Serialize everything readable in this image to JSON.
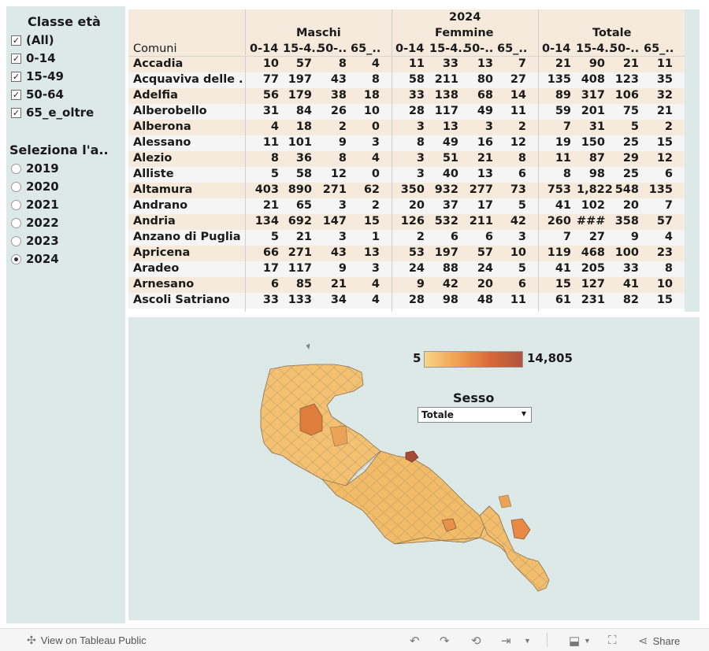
{
  "filters": {
    "age_class": {
      "title": "Classe età",
      "options": [
        {
          "label": "(All)",
          "checked": true
        },
        {
          "label": "0-14",
          "checked": true
        },
        {
          "label": "15-49",
          "checked": true
        },
        {
          "label": "50-64",
          "checked": true
        },
        {
          "label": "65_e_oltre",
          "checked": true
        }
      ]
    },
    "year": {
      "title": "Seleziona l'a..",
      "options": [
        {
          "label": "2019",
          "selected": false
        },
        {
          "label": "2020",
          "selected": false
        },
        {
          "label": "2021",
          "selected": false
        },
        {
          "label": "2022",
          "selected": false
        },
        {
          "label": "2023",
          "selected": false
        },
        {
          "label": "2024",
          "selected": true
        }
      ]
    }
  },
  "table": {
    "year_header": "2024",
    "row_header": "Comuni",
    "groups": [
      "Maschi",
      "Femmine",
      "Totale"
    ],
    "subcolumns": [
      "0-14",
      "15-4..",
      "50-..",
      "65_.."
    ],
    "rows": [
      {
        "name": "Accadia",
        "values": [
          "10",
          "57",
          "8",
          "4",
          "11",
          "33",
          "13",
          "7",
          "21",
          "90",
          "21",
          "11"
        ]
      },
      {
        "name": "Acquaviva delle ..",
        "values": [
          "77",
          "197",
          "43",
          "8",
          "58",
          "211",
          "80",
          "27",
          "135",
          "408",
          "123",
          "35"
        ]
      },
      {
        "name": "Adelfia",
        "values": [
          "56",
          "179",
          "38",
          "18",
          "33",
          "138",
          "68",
          "14",
          "89",
          "317",
          "106",
          "32"
        ]
      },
      {
        "name": "Alberobello",
        "values": [
          "31",
          "84",
          "26",
          "10",
          "28",
          "117",
          "49",
          "11",
          "59",
          "201",
          "75",
          "21"
        ]
      },
      {
        "name": "Alberona",
        "values": [
          "4",
          "18",
          "2",
          "0",
          "3",
          "13",
          "3",
          "2",
          "7",
          "31",
          "5",
          "2"
        ]
      },
      {
        "name": "Alessano",
        "values": [
          "11",
          "101",
          "9",
          "3",
          "8",
          "49",
          "16",
          "12",
          "19",
          "150",
          "25",
          "15"
        ]
      },
      {
        "name": "Alezio",
        "values": [
          "8",
          "36",
          "8",
          "4",
          "3",
          "51",
          "21",
          "8",
          "11",
          "87",
          "29",
          "12"
        ]
      },
      {
        "name": "Alliste",
        "values": [
          "5",
          "58",
          "12",
          "0",
          "3",
          "40",
          "13",
          "6",
          "8",
          "98",
          "25",
          "6"
        ]
      },
      {
        "name": "Altamura",
        "values": [
          "403",
          "890",
          "271",
          "62",
          "350",
          "932",
          "277",
          "73",
          "753",
          "1,822",
          "548",
          "135"
        ]
      },
      {
        "name": "Andrano",
        "values": [
          "21",
          "65",
          "3",
          "2",
          "20",
          "37",
          "17",
          "5",
          "41",
          "102",
          "20",
          "7"
        ]
      },
      {
        "name": "Andria",
        "values": [
          "134",
          "692",
          "147",
          "15",
          "126",
          "532",
          "211",
          "42",
          "260",
          "###",
          "358",
          "57"
        ]
      },
      {
        "name": "Anzano di Puglia",
        "values": [
          "5",
          "21",
          "3",
          "1",
          "2",
          "6",
          "6",
          "3",
          "7",
          "27",
          "9",
          "4"
        ]
      },
      {
        "name": "Apricena",
        "values": [
          "66",
          "271",
          "43",
          "13",
          "53",
          "197",
          "57",
          "10",
          "119",
          "468",
          "100",
          "23"
        ]
      },
      {
        "name": "Aradeo",
        "values": [
          "17",
          "117",
          "9",
          "3",
          "24",
          "88",
          "24",
          "5",
          "41",
          "205",
          "33",
          "8"
        ]
      },
      {
        "name": "Arnesano",
        "values": [
          "6",
          "85",
          "21",
          "4",
          "9",
          "42",
          "20",
          "6",
          "15",
          "127",
          "41",
          "10"
        ]
      },
      {
        "name": "Ascoli Satriano",
        "values": [
          "33",
          "133",
          "34",
          "4",
          "28",
          "98",
          "48",
          "11",
          "61",
          "231",
          "82",
          "15"
        ]
      }
    ]
  },
  "map": {
    "legend_min": "5",
    "legend_max": "14,805",
    "color_low": "#f6d688",
    "color_high": "#b0533e",
    "sesso_title": "Sesso",
    "sesso_value": "Totale"
  },
  "footer": {
    "view_label": "View on Tableau Public",
    "share_label": "Share"
  }
}
